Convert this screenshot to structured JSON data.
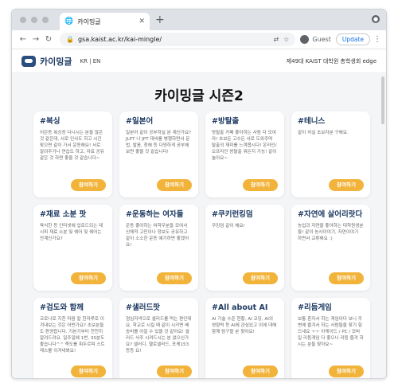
{
  "browser": {
    "tab_title": "카이밍글",
    "url": "gsa.kaist.ac.kr/kai-mingle/",
    "profile_label": "Guest",
    "update_label": "Update"
  },
  "site": {
    "logo_text": "카이밍글",
    "lang": "KR | EN",
    "council": "제49대 KAIST 대학원 총학생회 edge"
  },
  "page": {
    "title": "카이밍글 시즌2",
    "join_label": "참여하기"
  },
  "cards": [
    {
      "title": "#복싱",
      "desc": "어은동 복싱장 다니시는 분들 많은 것 같은데, 서로 인사도 하고 시간 맞으면 같이 가서 운동해요! 서로 알려주거나 연습도 하고, 자료 공유 같은 것 하면 좋을 것 같습니다~"
    },
    {
      "title": "#일본어",
      "desc": "일본어 같이 공부하실 분 계신가요? JLPT 나 JPT 대비를 병행하면서 문법, 발음, 청해 등 다양하게 공부해보면 좋을 것 같습니다!"
    },
    {
      "title": "#방탈출",
      "desc": "방탈출 카페 좋아하는 사람 다 모여라! 초보든 고수든 서로 도와주며 탈출의 재미를 느껴봅시다! 온라인/오프라인 방탈출 뭐든지 가능! 같이 놀아요~"
    },
    {
      "title": "#테니스",
      "desc": "같이 치실 초보자분 구해요."
    },
    {
      "title": "#재료 소분 팟",
      "desc": "육식한 등 인터넷에 업로드되는 레시피 재료 소분 및 쉐어 및 쉐어는 안계신가요?"
    },
    {
      "title": "#운동하는 여자들",
      "desc": "운동 좋아하는 여학우분들 모여서 신체적 고민이나 정보도 공유하고 같이 소소한 운동 얘기하면 좋겠어요!"
    },
    {
      "title": "#쿠키런킹덤",
      "desc": "쿠킹덤 같이 해요!"
    },
    {
      "title": "#자연에 살어리랏다",
      "desc": "농업과 자연을 좋아하는 대학원생분들! 같이 농사이야기, 자연이야기 하면서 교류해요 :)"
    },
    {
      "title": "#검도와 함께",
      "desc": "코로나로 지친 마음 칼 한자루로 이겨내보는 것은 어떤가요? 초보분들도 환영합니다. 기본기부터 천천히 알려드려요. 일주일에 1번, 30분도 좋습니다^^ 죽도를 휘두르며 스트레스를 이겨내봐요!"
    },
    {
      "title": "#샐러드팟",
      "desc": "점심저녁으로 샐러드를 먹는 편인데요, 학교로 시킬 때 같이 시키면 배송비를 아낄 수 있을 것 같아요! 샐러드 사주 시켜드시는 분 없으신가요? 샐러디, 헬로샐러드, 포케153 등등 요!"
    },
    {
      "title": "#All about AI",
      "desc": "AI 기술 수준 현황, AI 코딩, AI의 영향력 등 AI에 관심있고 이에 대해 함께 탐구할 분 찾아요!"
    },
    {
      "title": "#리듬게임",
      "desc": "보통 혼자서 하는 게임이다 보니 주변에 즐겨서 하는 사람들을 찾기 힘드네요 ㅜㅜ 아케이드 / PC / 모바일 리듬게임 다 좋으니 리듬 즐겨 하시는 분들 찾아요~"
    }
  ],
  "colors": {
    "accent": "#f2b33a",
    "title_blue": "#1f3b63"
  }
}
